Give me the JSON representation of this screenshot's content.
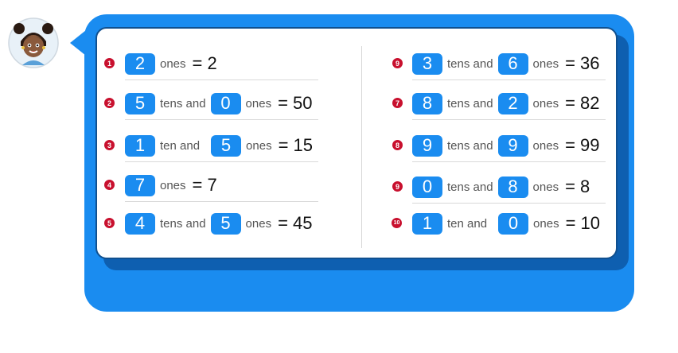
{
  "rows": [
    {
      "number": "1",
      "a": "2",
      "w1": "ones",
      "result": "= 2"
    },
    {
      "number": "2",
      "a": "5",
      "w1": "tens and",
      "b": "0",
      "w2": "ones",
      "result": "= 50"
    },
    {
      "number": "3",
      "a": "1",
      "w1": "ten and",
      "b": "5",
      "w2": "ones",
      "result": "= 15"
    },
    {
      "number": "4",
      "a": "7",
      "w1": "ones",
      "result": "= 7"
    },
    {
      "number": "5",
      "a": "4",
      "w1": "tens and",
      "b": "5",
      "w2": "ones",
      "result": "= 45"
    },
    {
      "number": "9",
      "a": "3",
      "w1": "tens and",
      "b": "6",
      "w2": "ones",
      "result": "= 36"
    },
    {
      "number": "7",
      "a": "8",
      "w1": "tens and",
      "b": "2",
      "w2": "ones",
      "result": "= 82"
    },
    {
      "number": "8",
      "a": "9",
      "w1": "tens and",
      "b": "9",
      "w2": "ones",
      "result": "= 99"
    },
    {
      "number": "9",
      "a": "0",
      "w1": "tens and",
      "b": "8",
      "w2": "ones",
      "result": "= 8"
    },
    {
      "number": "10",
      "a": "1",
      "w1": "ten and",
      "b": "0",
      "w2": "ones",
      "result": "= 10"
    }
  ],
  "colors": {
    "accent": "#1a8cf0",
    "number_badge": "#c8102e"
  },
  "avatar_icon": "girl-avatar-icon"
}
